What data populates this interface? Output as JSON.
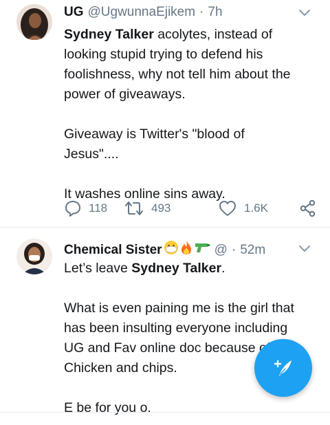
{
  "tweets": [
    {
      "display_name": "UG",
      "handle": "@UgwunnaEjikem",
      "time": "7h",
      "body": [
        [
          {
            "b": "Sydney Talker"
          },
          {
            "t": " acolytes, instead of"
          }
        ],
        [
          {
            "t": "looking stupid trying to defend his"
          }
        ],
        [
          {
            "t": "foolishness, why not tell him about the"
          }
        ],
        [
          {
            "t": "power of giveaways."
          }
        ],
        [],
        [
          {
            "t": "Giveaway is Twitter's \"blood of"
          }
        ],
        [
          {
            "t": "Jesus\"...."
          }
        ],
        [],
        [
          {
            "t": "It washes online sins away."
          }
        ]
      ],
      "replies": "118",
      "retweets": "493",
      "likes": "1.6K"
    },
    {
      "display_name": "Chemical Sister",
      "handle": "@",
      "time": "52m",
      "body": [
        [
          {
            "t": "Let’s leave "
          },
          {
            "b": "Sydney Talker"
          },
          {
            "t": "."
          }
        ],
        [],
        [
          {
            "t": "What is even paining me is the girl that"
          }
        ],
        [
          {
            "t": "has been insulting everyone including"
          }
        ],
        [
          {
            "t": "UG and Fav online doc because of"
          }
        ],
        [
          {
            "t": "Chicken and chips."
          }
        ],
        [],
        [
          {
            "t": "E be for you o."
          }
        ]
      ]
    }
  ],
  "icons": {
    "reply": "reply-icon",
    "retweet": "retweet-icon",
    "like": "heart-icon",
    "share": "share-icon",
    "more": "chevron-down-icon",
    "compose": "compose-tweet-icon"
  },
  "colors": {
    "accent": "#1da1f2",
    "secondary_text": "#657786",
    "primary_text": "#14171a",
    "divider": "#e6ecf0"
  }
}
